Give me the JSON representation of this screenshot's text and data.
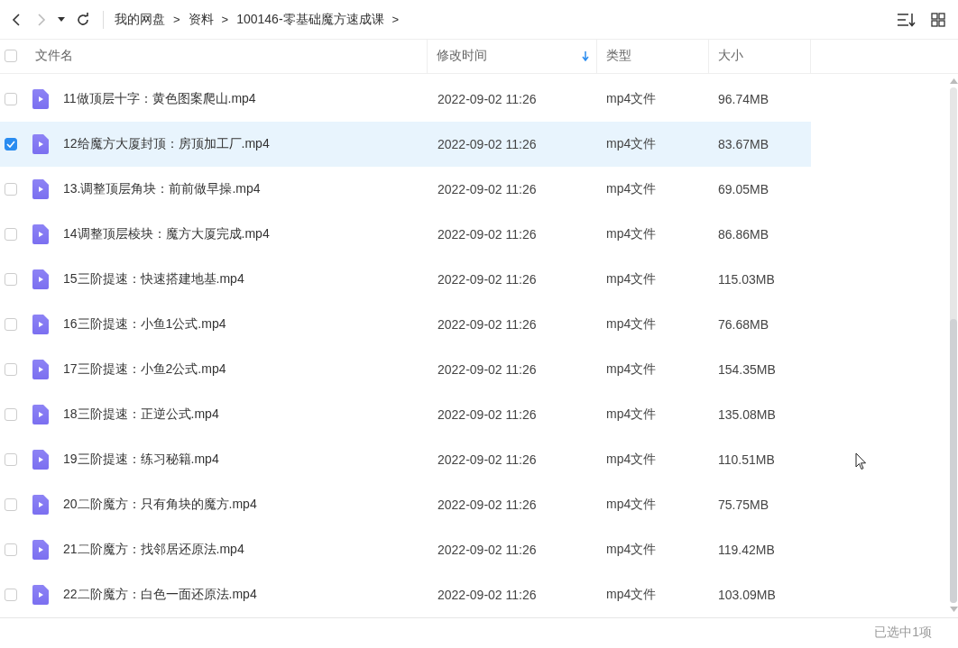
{
  "breadcrumbs": [
    {
      "label": "我的网盘"
    },
    {
      "label": "资料"
    },
    {
      "label": "100146-零基础魔方速成课"
    }
  ],
  "separator": ">",
  "select_all": {
    "checked": false
  },
  "columns": [
    {
      "label": "文件名",
      "sorted": false
    },
    {
      "label": "修改时间",
      "sorted": true
    },
    {
      "label": "类型",
      "sorted": false
    },
    {
      "label": "大小",
      "sorted": false
    }
  ],
  "rows": [
    {
      "name": "11做顶层十字：黄色图案爬山.mp4",
      "modified": "2022-09-02 11:26",
      "type": "mp4文件",
      "size": "96.74MB",
      "selected": false
    },
    {
      "name": "12给魔方大厦封顶：房顶加工厂.mp4",
      "modified": "2022-09-02 11:26",
      "type": "mp4文件",
      "size": "83.67MB",
      "selected": true
    },
    {
      "name": "13.调整顶层角块：前前做早操.mp4",
      "modified": "2022-09-02 11:26",
      "type": "mp4文件",
      "size": "69.05MB",
      "selected": false
    },
    {
      "name": "14调整顶层棱块：魔方大厦完成.mp4",
      "modified": "2022-09-02 11:26",
      "type": "mp4文件",
      "size": "86.86MB",
      "selected": false
    },
    {
      "name": "15三阶提速：快速搭建地基.mp4",
      "modified": "2022-09-02 11:26",
      "type": "mp4文件",
      "size": "115.03MB",
      "selected": false
    },
    {
      "name": "16三阶提速：小鱼1公式.mp4",
      "modified": "2022-09-02 11:26",
      "type": "mp4文件",
      "size": "76.68MB",
      "selected": false
    },
    {
      "name": "17三阶提速：小鱼2公式.mp4",
      "modified": "2022-09-02 11:26",
      "type": "mp4文件",
      "size": "154.35MB",
      "selected": false
    },
    {
      "name": "18三阶提速：正逆公式.mp4",
      "modified": "2022-09-02 11:26",
      "type": "mp4文件",
      "size": "135.08MB",
      "selected": false
    },
    {
      "name": "19三阶提速：练习秘籍.mp4",
      "modified": "2022-09-02 11:26",
      "type": "mp4文件",
      "size": "110.51MB",
      "selected": false
    },
    {
      "name": "20二阶魔方：只有角块的魔方.mp4",
      "modified": "2022-09-02 11:26",
      "type": "mp4文件",
      "size": "75.75MB",
      "selected": false
    },
    {
      "name": "21二阶魔方：找邻居还原法.mp4",
      "modified": "2022-09-02 11:26",
      "type": "mp4文件",
      "size": "119.42MB",
      "selected": false
    },
    {
      "name": "22二阶魔方：白色一面还原法.mp4",
      "modified": "2022-09-02 11:26",
      "type": "mp4文件",
      "size": "103.09MB",
      "selected": false
    }
  ],
  "status": "已选中1项"
}
